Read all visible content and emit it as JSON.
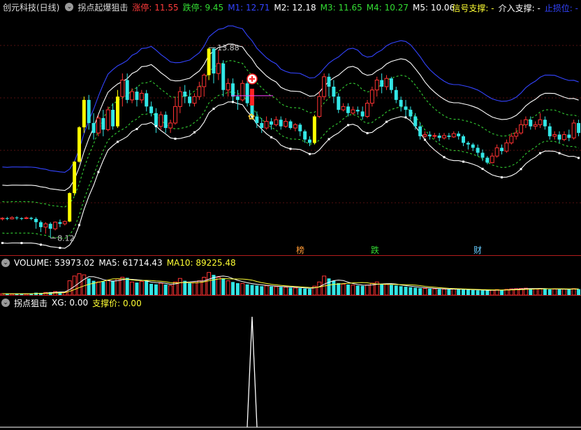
{
  "header": {
    "stock_name": "创元科技(日线)",
    "indicator": "拐点起爆狙击",
    "values": [
      {
        "label": "涨停: ",
        "value": "11.55",
        "color": "#ff3b3b"
      },
      {
        "label": "跌停: ",
        "value": "9.45",
        "color": "#33dd33"
      },
      {
        "label": "M1: ",
        "value": "12.71",
        "color": "#3344ff"
      },
      {
        "label": "M2: ",
        "value": "12.18",
        "color": "#ffffff"
      },
      {
        "label": "M3: ",
        "value": "11.65",
        "color": "#33dd33"
      },
      {
        "label": "M4: ",
        "value": "10.27",
        "color": "#33dd33"
      },
      {
        "label": "M5: ",
        "value": "10.06",
        "color": "#ffffff"
      }
    ],
    "right": [
      {
        "text": "信号支撑: -",
        "color": "#ffff33"
      },
      {
        "text": "介入支撑: -",
        "color": "#ffffff"
      },
      {
        "text": "止损位: -",
        "color": "#3344ff"
      }
    ]
  },
  "price_chart": {
    "high_label": "13.88",
    "low_label": "8.12",
    "markers": [
      {
        "text": "榜",
        "color": "#ff9933"
      },
      {
        "text": "跌",
        "color": "#33dd33"
      },
      {
        "text": "财",
        "color": "#66ccff"
      }
    ]
  },
  "volume_panel": {
    "title": "VOLUME: 53973.02",
    "ma5": "MA5: 61714.43",
    "ma10": "MA10: 89225.48",
    "colors": {
      "title": "#ffffff",
      "ma5": "#ffffff",
      "ma10": "#ffff33"
    }
  },
  "signal_panel": {
    "title": "拐点狙击",
    "xg": "XG: 0.00",
    "support": "支撑价: 0.00",
    "colors": {
      "title": "#ffffff",
      "xg": "#ffffff",
      "support": "#ffff33"
    }
  },
  "chart_data": {
    "type": "line",
    "candles": [
      [
        8.7,
        8.72,
        8.65,
        8.75
      ],
      [
        8.72,
        8.7,
        8.66,
        8.76
      ],
      [
        8.7,
        8.74,
        8.68,
        8.78
      ],
      [
        8.74,
        8.72,
        8.67,
        8.78
      ],
      [
        8.72,
        8.71,
        8.66,
        8.75
      ],
      [
        8.71,
        8.73,
        8.69,
        8.77
      ],
      [
        8.73,
        8.7,
        8.66,
        8.76
      ],
      [
        8.7,
        8.6,
        8.4,
        8.75
      ],
      [
        8.6,
        8.45,
        8.3,
        8.65
      ],
      [
        8.45,
        8.55,
        8.25,
        8.6
      ],
      [
        8.55,
        8.4,
        8.12,
        8.6
      ],
      [
        8.4,
        8.6,
        8.35,
        8.62
      ],
      [
        8.6,
        8.55,
        8.45,
        8.68
      ],
      [
        8.55,
        8.62,
        8.5,
        8.65
      ],
      [
        8.62,
        9.48,
        8.6,
        9.5
      ],
      [
        9.48,
        10.43,
        9.4,
        10.45
      ],
      [
        10.43,
        11.47,
        10.4,
        11.5
      ],
      [
        11.47,
        12.3,
        11.3,
        12.4
      ],
      [
        12.3,
        11.6,
        11.4,
        12.45
      ],
      [
        11.6,
        11.3,
        11.1,
        11.9
      ],
      [
        11.3,
        11.75,
        11.2,
        11.85
      ],
      [
        11.75,
        11.4,
        11.2,
        12.0
      ],
      [
        11.4,
        12.0,
        11.35,
        12.1
      ],
      [
        12.0,
        11.5,
        11.4,
        12.2
      ],
      [
        11.5,
        12.4,
        11.45,
        12.6
      ],
      [
        12.4,
        12.9,
        12.1,
        13.1
      ],
      [
        12.9,
        12.3,
        12.2,
        13.1
      ],
      [
        12.3,
        12.55,
        12.2,
        12.65
      ],
      [
        12.55,
        12.3,
        12.1,
        12.7
      ],
      [
        12.3,
        12.5,
        12.2,
        12.6
      ],
      [
        12.5,
        12.1,
        11.95,
        12.6
      ],
      [
        12.1,
        11.9,
        11.8,
        12.25
      ],
      [
        11.9,
        11.5,
        11.3,
        12.05
      ],
      [
        11.5,
        11.85,
        11.4,
        11.95
      ],
      [
        11.85,
        11.45,
        11.3,
        11.95
      ],
      [
        11.45,
        11.6,
        11.3,
        11.7
      ],
      [
        11.6,
        12.1,
        11.55,
        12.4
      ],
      [
        12.1,
        12.55,
        11.9,
        12.7
      ],
      [
        12.55,
        12.4,
        12.2,
        12.75
      ],
      [
        12.4,
        12.2,
        12.1,
        12.6
      ],
      [
        12.2,
        12.4,
        12.1,
        12.5
      ],
      [
        12.4,
        12.7,
        12.3,
        12.85
      ],
      [
        12.7,
        13.05,
        12.4,
        13.1
      ],
      [
        13.05,
        13.85,
        12.9,
        13.88
      ],
      [
        13.85,
        13.1,
        12.8,
        13.88
      ],
      [
        13.1,
        13.4,
        12.9,
        13.8
      ],
      [
        13.4,
        12.6,
        12.4,
        13.5
      ],
      [
        12.6,
        12.8,
        12.4,
        12.95
      ],
      [
        12.8,
        12.4,
        12.2,
        12.95
      ],
      [
        12.4,
        12.3,
        12.0,
        12.6
      ],
      [
        12.3,
        12.8,
        12.25,
        12.9
      ],
      [
        12.8,
        12.2,
        12.1,
        12.95
      ],
      [
        12.2,
        11.8,
        11.7,
        12.3
      ],
      [
        11.8,
        11.6,
        11.45,
        11.95
      ],
      [
        11.6,
        11.45,
        11.3,
        11.75
      ],
      [
        11.45,
        11.65,
        11.4,
        11.8
      ],
      [
        11.65,
        11.55,
        11.4,
        11.75
      ],
      [
        11.55,
        11.7,
        11.5,
        11.8
      ],
      [
        11.7,
        11.5,
        11.4,
        11.8
      ],
      [
        11.5,
        11.65,
        11.45,
        11.75
      ],
      [
        11.65,
        11.45,
        11.4,
        11.7
      ],
      [
        11.45,
        11.55,
        11.35,
        11.6
      ],
      [
        11.55,
        11.35,
        11.2,
        11.6
      ],
      [
        11.35,
        11.1,
        11.0,
        11.4
      ],
      [
        11.1,
        11.0,
        10.9,
        11.2
      ],
      [
        11.0,
        11.8,
        10.95,
        11.85
      ],
      [
        11.8,
        12.4,
        11.75,
        12.55
      ],
      [
        12.4,
        13.0,
        12.3,
        13.1
      ],
      [
        13.0,
        12.7,
        12.4,
        13.1
      ],
      [
        12.7,
        12.4,
        12.2,
        12.9
      ],
      [
        12.4,
        12.0,
        11.9,
        12.5
      ],
      [
        12.0,
        12.1,
        11.95,
        12.2
      ],
      [
        12.1,
        11.9,
        11.8,
        12.2
      ],
      [
        11.9,
        12.0,
        11.85,
        12.1
      ],
      [
        12.0,
        11.95,
        11.85,
        12.1
      ],
      [
        11.95,
        11.8,
        11.7,
        12.1
      ],
      [
        11.8,
        12.2,
        11.75,
        12.3
      ],
      [
        12.2,
        12.6,
        12.1,
        12.7
      ],
      [
        12.6,
        12.9,
        12.4,
        13.0
      ],
      [
        12.9,
        12.7,
        12.5,
        13.1
      ],
      [
        12.7,
        12.95,
        12.6,
        13.05
      ],
      [
        12.95,
        12.6,
        12.5,
        13.0
      ],
      [
        12.6,
        12.3,
        12.2,
        12.7
      ],
      [
        12.3,
        12.1,
        11.95,
        12.4
      ],
      [
        12.1,
        12.0,
        11.8,
        12.3
      ],
      [
        12.0,
        11.8,
        11.7,
        12.1
      ],
      [
        11.8,
        11.5,
        11.4,
        11.9
      ],
      [
        11.5,
        11.2,
        11.1,
        11.6
      ],
      [
        11.2,
        11.25,
        11.15,
        11.35
      ],
      [
        11.25,
        11.2,
        11.1,
        11.35
      ],
      [
        11.2,
        11.22,
        11.12,
        11.3
      ],
      [
        11.22,
        11.15,
        11.05,
        11.3
      ],
      [
        11.15,
        11.22,
        11.1,
        11.3
      ],
      [
        11.22,
        11.18,
        11.1,
        11.3
      ],
      [
        11.18,
        11.28,
        11.15,
        11.35
      ],
      [
        11.28,
        11.2,
        11.1,
        11.35
      ],
      [
        11.2,
        11.0,
        10.9,
        11.25
      ],
      [
        11.0,
        10.95,
        10.8,
        11.05
      ],
      [
        10.95,
        10.85,
        10.75,
        11.0
      ],
      [
        10.85,
        10.7,
        10.6,
        10.95
      ],
      [
        10.7,
        10.55,
        10.45,
        10.8
      ],
      [
        10.55,
        10.4,
        10.35,
        10.6
      ],
      [
        10.4,
        10.6,
        10.38,
        10.7
      ],
      [
        10.6,
        10.85,
        10.55,
        10.95
      ],
      [
        10.85,
        10.75,
        10.65,
        10.95
      ],
      [
        10.75,
        11.0,
        10.7,
        11.1
      ],
      [
        11.0,
        11.2,
        10.95,
        11.3
      ],
      [
        11.2,
        11.3,
        11.1,
        11.45
      ],
      [
        11.3,
        11.55,
        11.25,
        11.7
      ],
      [
        11.55,
        11.7,
        11.45,
        11.8
      ],
      [
        11.7,
        11.5,
        11.4,
        11.8
      ],
      [
        11.5,
        11.55,
        11.4,
        11.65
      ],
      [
        11.55,
        11.7,
        11.45,
        11.9
      ],
      [
        11.7,
        11.5,
        11.4,
        11.8
      ],
      [
        11.5,
        11.2,
        11.1,
        11.6
      ],
      [
        11.2,
        11.25,
        11.1,
        11.35
      ],
      [
        11.25,
        11.1,
        11.0,
        11.35
      ],
      [
        11.1,
        11.25,
        11.05,
        11.35
      ],
      [
        11.25,
        11.15,
        11.05,
        11.4
      ],
      [
        11.15,
        11.6,
        11.1,
        11.7
      ],
      [
        11.6,
        11.3,
        11.2,
        11.7
      ]
    ],
    "volume": [
      12,
      11,
      10,
      12,
      11,
      10,
      13,
      20,
      18,
      22,
      25,
      30,
      28,
      26,
      120,
      160,
      180,
      170,
      140,
      120,
      110,
      115,
      125,
      118,
      135,
      150,
      145,
      110,
      105,
      115,
      120,
      95,
      90,
      100,
      88,
      80,
      110,
      140,
      120,
      100,
      105,
      120,
      150,
      190,
      170,
      150,
      140,
      120,
      110,
      100,
      98,
      90,
      85,
      80,
      75,
      78,
      72,
      70,
      68,
      66,
      62,
      60,
      58,
      55,
      52,
      75,
      110,
      160,
      140,
      120,
      100,
      92,
      88,
      84,
      80,
      78,
      85,
      100,
      110,
      95,
      90,
      86,
      80,
      75,
      70,
      66,
      62,
      58,
      56,
      54,
      52,
      50,
      50,
      48,
      50,
      48,
      46,
      44,
      42,
      40,
      40,
      38,
      42,
      46,
      44,
      48,
      52,
      54,
      56,
      58,
      54,
      52,
      55,
      52,
      48,
      50,
      48,
      50,
      52,
      54,
      50
    ],
    "signal": {
      "index": 52,
      "value": 1
    }
  }
}
